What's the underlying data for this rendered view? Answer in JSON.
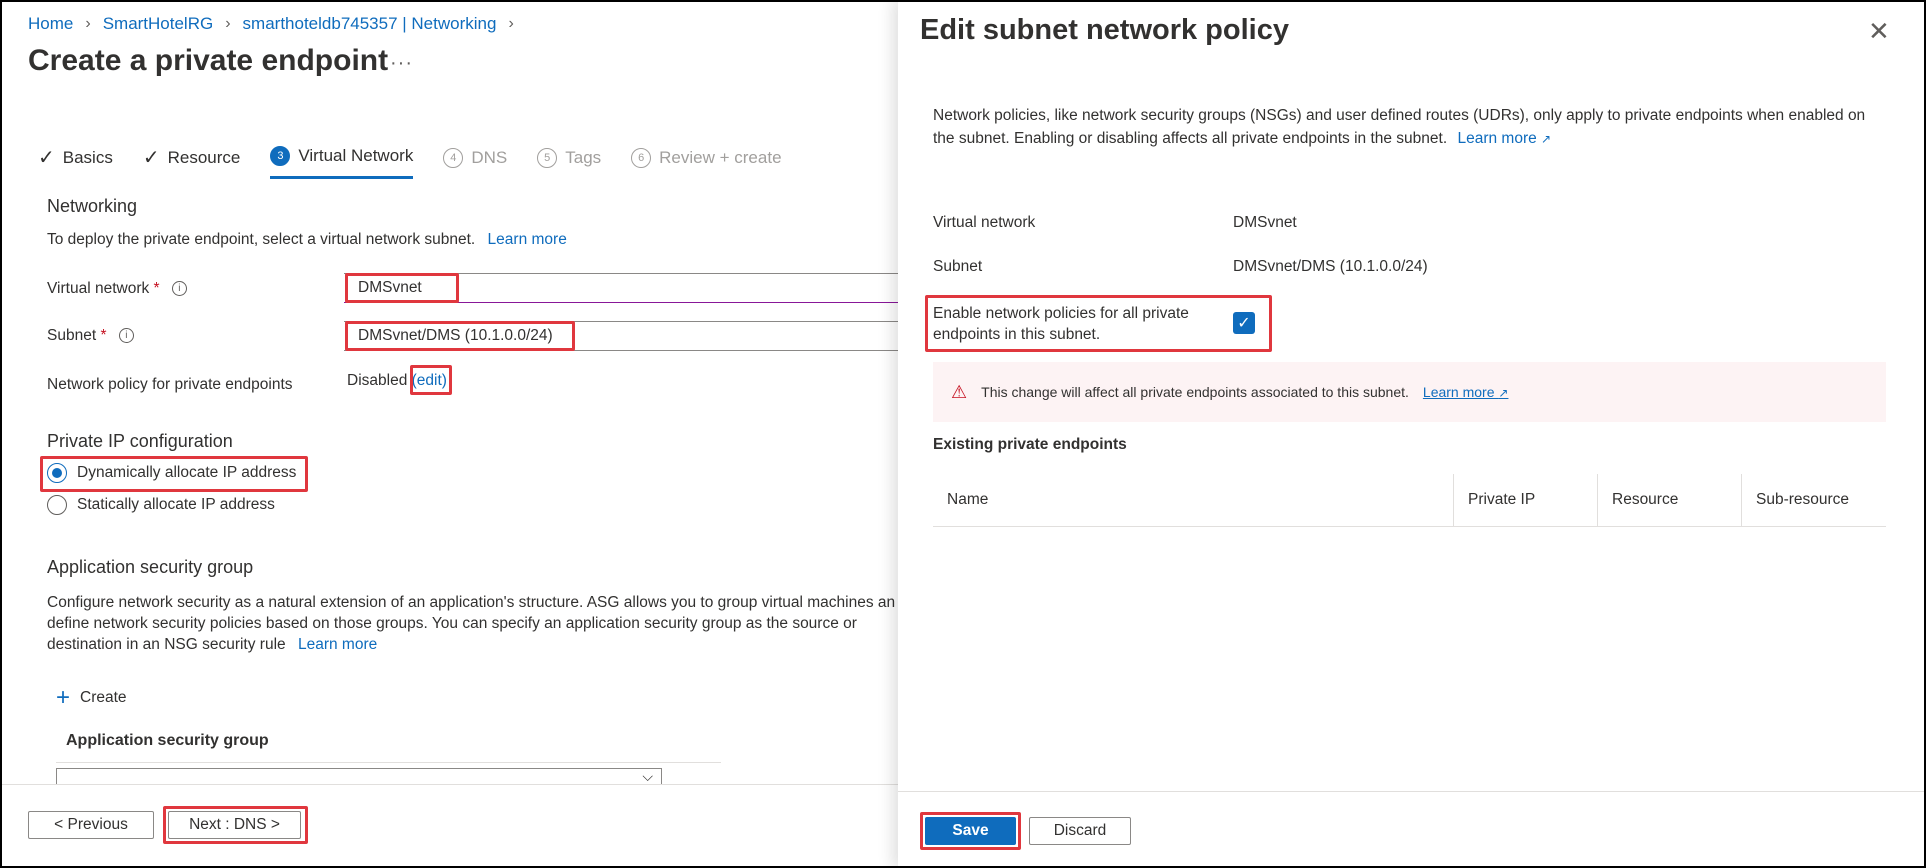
{
  "breadcrumb": [
    "Home",
    "SmartHotelRG",
    "smarthoteldb745357 | Networking"
  ],
  "page": {
    "title": "Create a private endpoint",
    "more": "···"
  },
  "tabs": [
    {
      "label": "Basics",
      "state": "done"
    },
    {
      "label": "Resource",
      "state": "done"
    },
    {
      "num": "3",
      "label": "Virtual Network",
      "state": "active"
    },
    {
      "num": "4",
      "label": "DNS",
      "state": "disabled"
    },
    {
      "num": "5",
      "label": "Tags",
      "state": "disabled"
    },
    {
      "num": "6",
      "label": "Review + create",
      "state": "disabled"
    }
  ],
  "networking": {
    "heading": "Networking",
    "description": "To deploy the private endpoint, select a virtual network subnet.",
    "learn_more": "Learn more",
    "vnet_label": "Virtual network",
    "vnet_value": "DMSvnet",
    "subnet_label": "Subnet",
    "subnet_value": "DMSvnet/DMS (10.1.0.0/24)",
    "policy_label": "Network policy for private endpoints",
    "policy_value": "Disabled",
    "policy_edit": "(edit)",
    "required_mark": "*"
  },
  "private_ip": {
    "heading": "Private IP configuration",
    "dynamic": "Dynamically allocate IP address",
    "static": "Statically allocate IP address"
  },
  "asg": {
    "heading": "Application security group",
    "line1": "Configure network security as a natural extension of an application's structure. ASG allows you to group virtual machines an",
    "line2": "define network security policies based on those groups. You can specify an application security group as the source or",
    "line3": "destination in an NSG security rule",
    "learn_more": "Learn more",
    "create": "Create",
    "column": "Application security group"
  },
  "footer": {
    "previous": "< Previous",
    "next": "Next : DNS >"
  },
  "panel": {
    "title": "Edit subnet network policy",
    "description_line1": "Network policies, like network security groups (NSGs) and user defined routes (UDRs), only apply to private endpoints when enabled on",
    "description_line2": "the subnet. Enabling or disabling affects all private endpoints in the subnet.",
    "learn_more": "Learn more",
    "vnet_label": "Virtual network",
    "vnet_value": "DMSvnet",
    "subnet_label": "Subnet",
    "subnet_value": "DMSvnet/DMS (10.1.0.0/24)",
    "enable_label_1": "Enable network policies for all private",
    "enable_label_2": "endpoints in this subnet.",
    "enable_checked": true,
    "warning_text": "This change will affect all private endpoints associated to this subnet.",
    "warning_learn_more": "Learn more",
    "existing_heading": "Existing private endpoints",
    "columns": [
      "Name",
      "Private IP",
      "Resource",
      "Sub-resource"
    ],
    "save": "Save",
    "discard": "Discard"
  },
  "colors": {
    "accent": "#0f6cbd",
    "highlight": "#e0373e",
    "warning_bg": "#fdf3f4",
    "error": "#c50f1f"
  }
}
